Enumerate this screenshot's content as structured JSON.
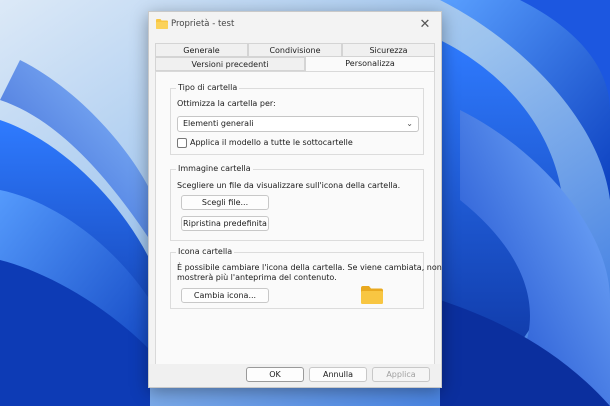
{
  "window": {
    "title": "Proprietà - test",
    "close_glyph": "✕"
  },
  "tabs": {
    "row_back": [
      {
        "label": "Generale"
      },
      {
        "label": "Condivisione"
      },
      {
        "label": "Sicurezza"
      }
    ],
    "row_front": [
      {
        "label": "Versioni precedenti"
      },
      {
        "label": "Personalizza"
      }
    ],
    "active": "Personalizza"
  },
  "folder_type": {
    "legend": "Tipo di cartella",
    "optimize_label": "Ottimizza la cartella per:",
    "optimize_value": "Elementi generali",
    "apply_template_label": "Applica il modello a tutte le sottocartelle",
    "apply_template_checked": false
  },
  "folder_image": {
    "legend": "Immagine cartella",
    "description": "Scegliere un file da visualizzare sull'icona della cartella.",
    "choose_file_label": "Scegli file...",
    "restore_default_label": "Ripristina predefinita"
  },
  "folder_icon": {
    "legend": "Icona cartella",
    "description_line1": "È possibile cambiare l'icona della cartella. Se viene cambiata, non",
    "description_line2": "mostrerà più l'anteprima del contenuto.",
    "change_icon_label": "Cambia icona..."
  },
  "footer": {
    "ok_label": "OK",
    "cancel_label": "Annulla",
    "apply_label": "Applica"
  },
  "colors": {
    "folder_yellow": "#f8c642",
    "wallpaper_blue": "#1f5fd6"
  },
  "icons": {
    "title_icon": "folder-icon",
    "preview_icon": "folder-icon",
    "dropdown_icon": "chevron-down-icon"
  }
}
